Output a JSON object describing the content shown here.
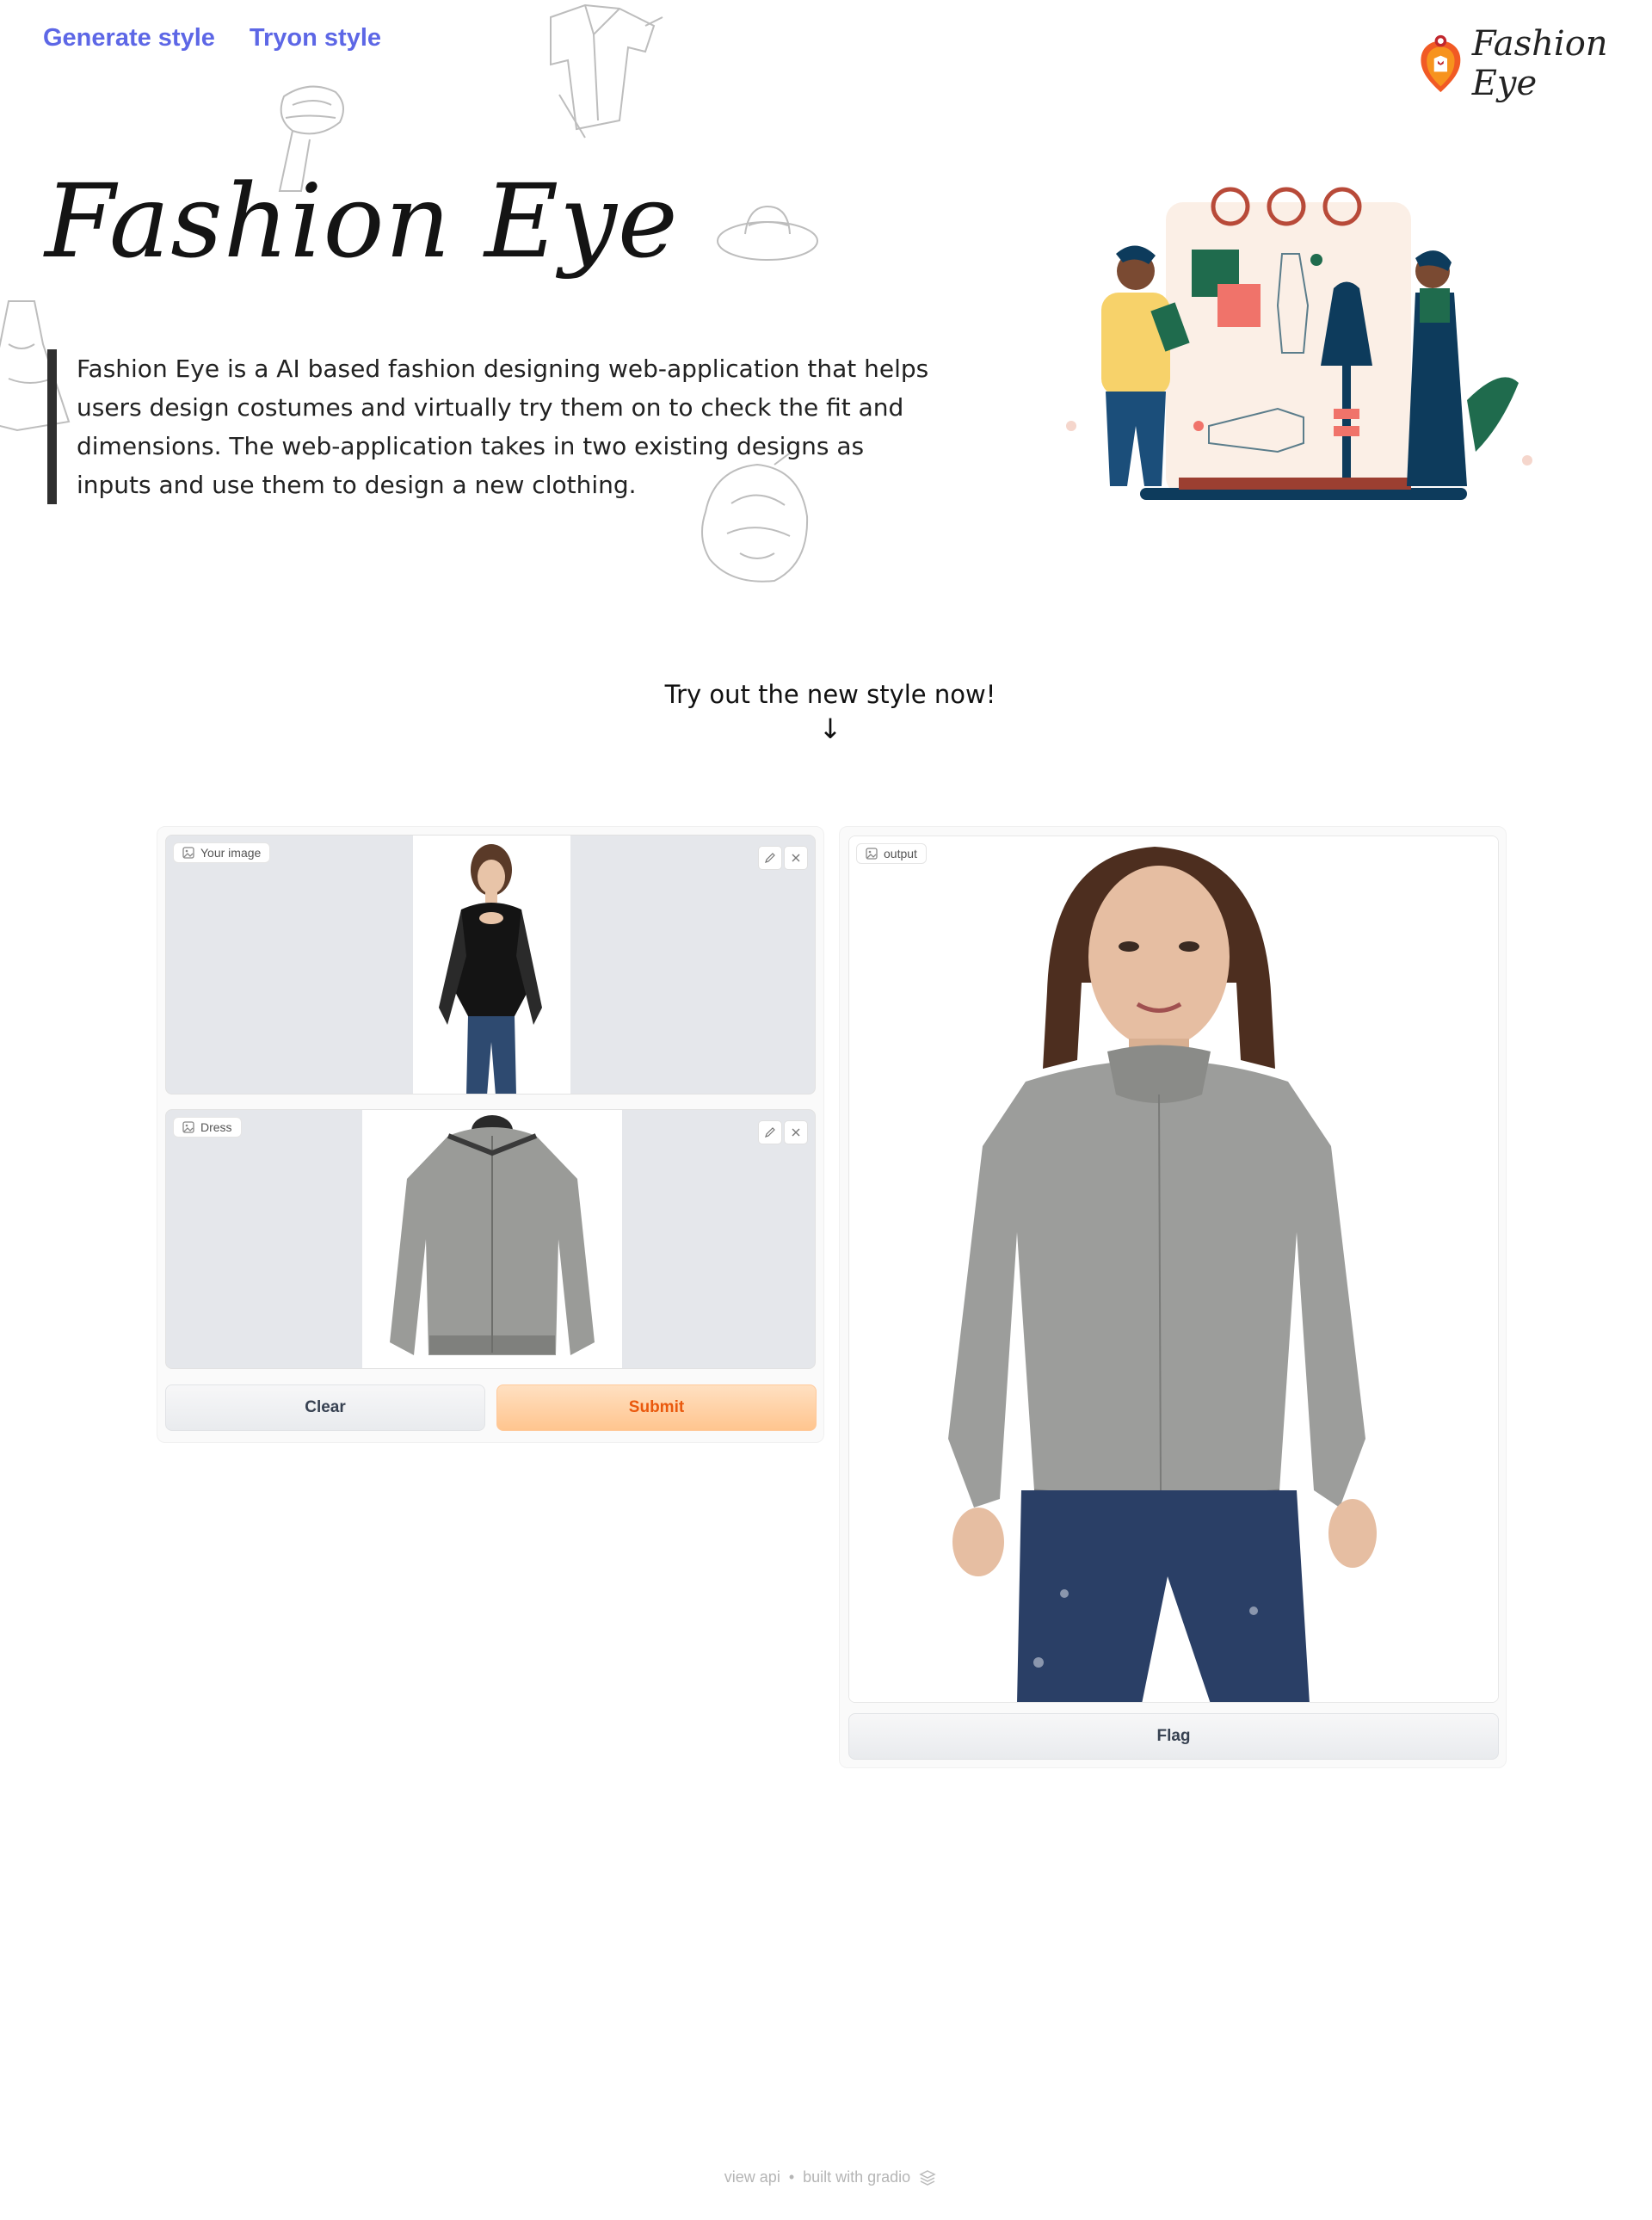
{
  "nav": {
    "items": [
      {
        "label": "Generate style"
      },
      {
        "label": "Tryon style"
      }
    ]
  },
  "logo": {
    "text": "Fashion Eye"
  },
  "hero": {
    "title": "Fashion Eye",
    "description": "Fashion Eye is a AI based fashion designing web-application that helps users design costumes and virtually try them on to check the fit and dimensions. The web-application takes in two existing designs as inputs and use them to design a new clothing."
  },
  "cta": {
    "text": "Try out the new style now!",
    "arrow": "↓"
  },
  "inputs": {
    "your_image": {
      "label": "Your image",
      "icon": "image-icon"
    },
    "dress": {
      "label": "Dress",
      "icon": "image-icon"
    }
  },
  "buttons": {
    "clear": "Clear",
    "submit": "Submit",
    "flag": "Flag"
  },
  "output": {
    "label": "output",
    "icon": "image-icon"
  },
  "footer": {
    "view_api": "view api",
    "separator": "•",
    "built_with": "built with gradio"
  },
  "colors": {
    "nav_link": "#5d67e6",
    "submit_text": "#ea580c",
    "submit_bg": "#ffc58f",
    "image_placeholder": "#e5e7eb",
    "accent_quote_bar": "#2f2f2f"
  }
}
